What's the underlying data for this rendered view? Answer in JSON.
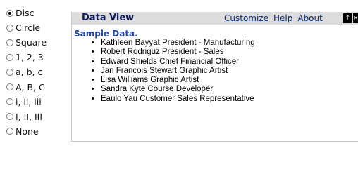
{
  "list_style_options": [
    {
      "label": "Disc",
      "checked": true
    },
    {
      "label": "Circle",
      "checked": false
    },
    {
      "label": "Square",
      "checked": false
    },
    {
      "label": "1, 2, 3",
      "checked": false
    },
    {
      "label": "a, b, c",
      "checked": false
    },
    {
      "label": "A, B, C",
      "checked": false
    },
    {
      "label": "i, ii, iii",
      "checked": false
    },
    {
      "label": "I, II, III",
      "checked": false
    },
    {
      "label": "None",
      "checked": false
    }
  ],
  "panel": {
    "title": "Data View",
    "links": [
      "Customize",
      "Help",
      "About"
    ],
    "heading": "Sample Data.",
    "items": [
      "Kathleen Bayyat President - Manufacturing",
      "Robert Rodriguz President - Sales",
      "Edward Shields Chief Financial Officer",
      "Jan Francois Stewart Graphic Artist",
      "Lisa Williams Graphic Artist",
      "Sandra Kyte Course Developer",
      "Eaulo Yau Customer Sales Representative"
    ],
    "icon_glyph": "⤒",
    "icon2_glyph": "×"
  }
}
